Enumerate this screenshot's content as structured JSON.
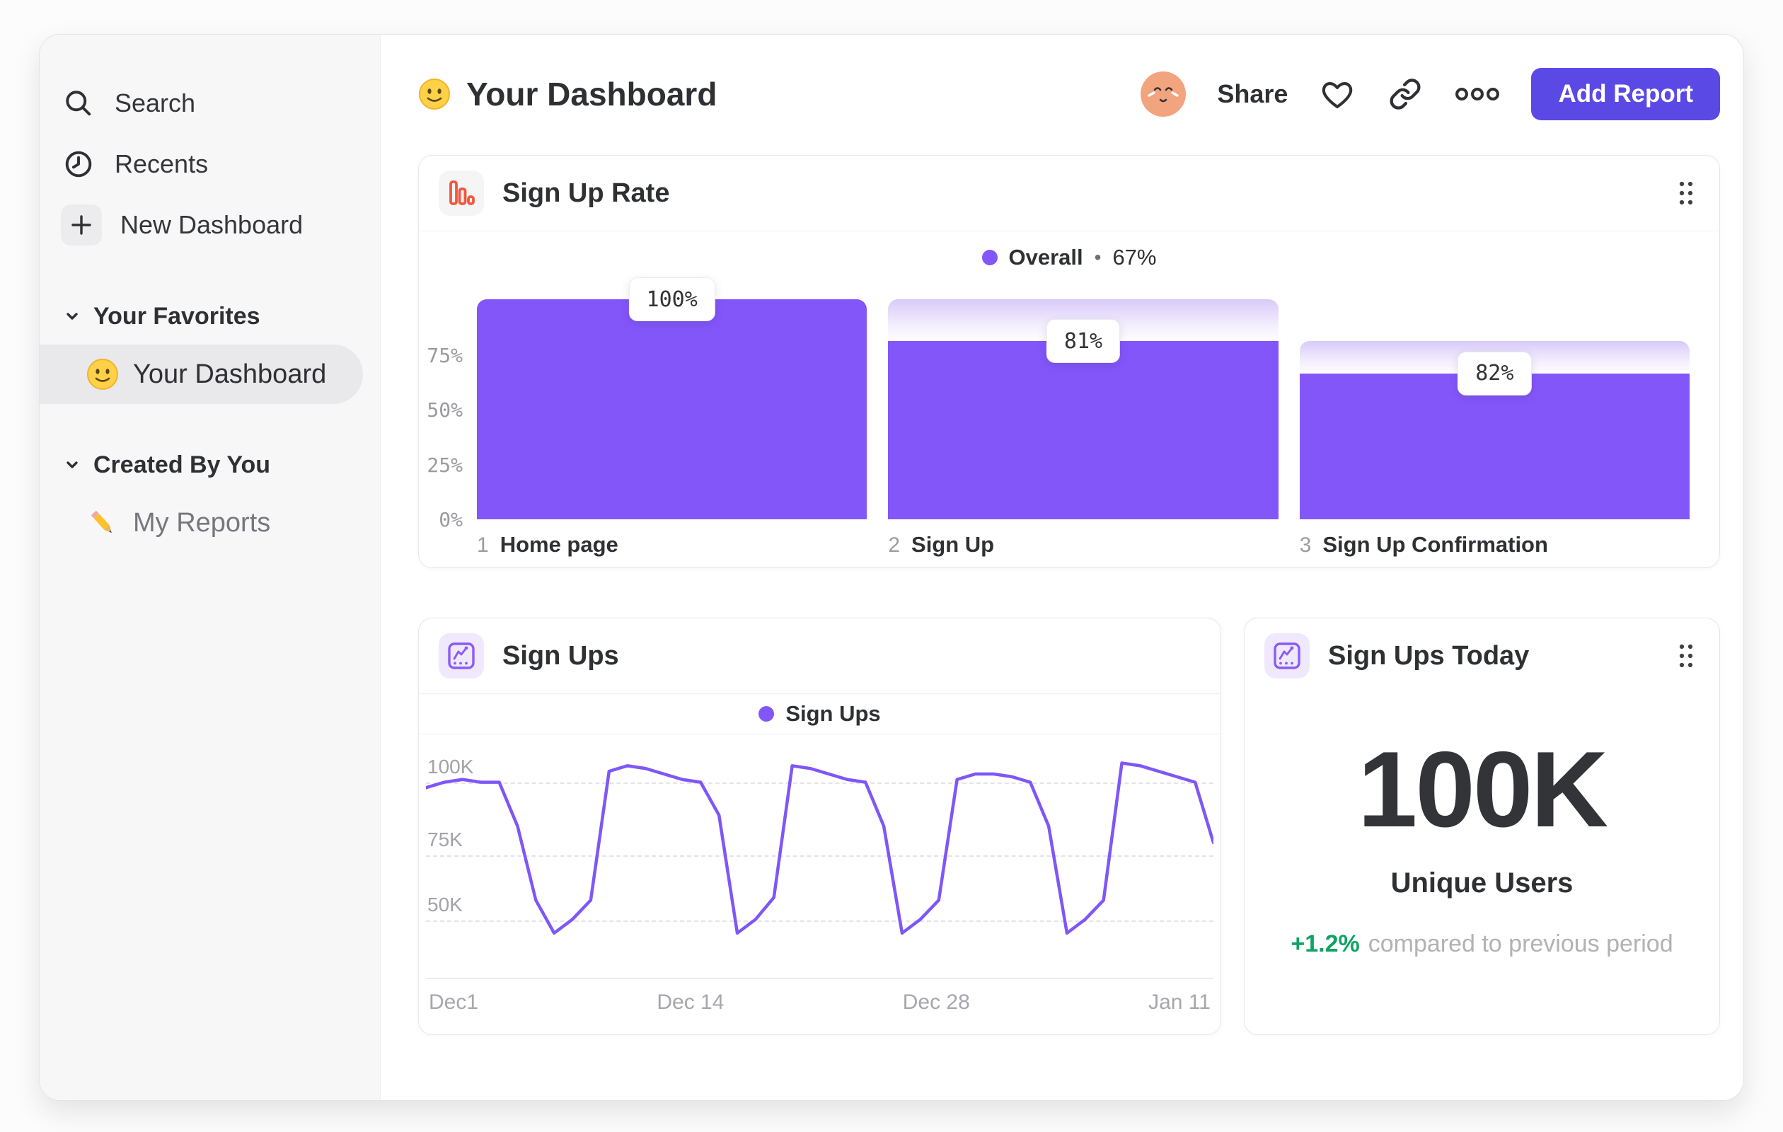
{
  "sidebar": {
    "items": [
      {
        "label": "Search",
        "icon": "search-icon"
      },
      {
        "label": "Recents",
        "icon": "clock-icon"
      },
      {
        "label": "New Dashboard",
        "icon": "plus-icon"
      }
    ],
    "sections": [
      {
        "label": "Your Favorites",
        "items": [
          {
            "label": "Your Dashboard",
            "icon": "smiley-emoji",
            "selected": true
          }
        ]
      },
      {
        "label": "Created By You",
        "items": [
          {
            "label": "My Reports",
            "icon": "pencil-emoji",
            "selected": false
          }
        ]
      }
    ]
  },
  "header": {
    "title": "Your Dashboard",
    "title_emoji": "smiley",
    "share_label": "Share",
    "add_report_label": "Add Report"
  },
  "cards": {
    "funnel": {
      "title": "Sign Up Rate",
      "legend": {
        "series": "Overall",
        "separator": "•",
        "value": "67%"
      }
    },
    "line": {
      "title": "Sign Ups",
      "legend": "Sign Ups"
    },
    "metric": {
      "title": "Sign Ups Today",
      "value": "100K",
      "caption": "Unique Users",
      "delta": "+1.2%",
      "delta_caption": "compared to previous period"
    }
  },
  "colors": {
    "accent_purple": "#8356fa",
    "line_purple": "#7e57f7",
    "button_indigo": "#5b49e6",
    "funnel_icon_orange": "#f2583e",
    "delta_green": "#0fa263",
    "sidebar_bg": "#f7f7f8",
    "grey_text": "#9b9ba1"
  },
  "chart_data": [
    {
      "type": "bar",
      "subtype": "funnel",
      "title": "Sign Up Rate",
      "categories": [
        "Home page",
        "Sign Up",
        "Sign Up Confirmation"
      ],
      "index_labels": [
        "1",
        "2",
        "3"
      ],
      "step_labels": [
        "100%",
        "81%",
        "82%"
      ],
      "step_conversion_pct": [
        100,
        81,
        82
      ],
      "cumulative_pct": [
        100,
        81,
        66.4
      ],
      "prev_cumulative_pct": [
        100,
        100,
        81
      ],
      "overall_conversion_pct": 67,
      "legend": "Overall",
      "ylim": [
        0,
        100
      ],
      "y_tick_values": [
        75,
        50,
        25,
        0
      ],
      "y_tick_labels": [
        "75%",
        "50%",
        "25%",
        "0%"
      ],
      "grid": false,
      "legend_position": "top-center"
    },
    {
      "type": "line",
      "title": "Sign Ups",
      "series": [
        {
          "name": "Sign Ups",
          "values_k": [
            98,
            100,
            101,
            100,
            100,
            84,
            57,
            45,
            50,
            57,
            104,
            106,
            105,
            103,
            101,
            100,
            88,
            45,
            50,
            58,
            106,
            105,
            103,
            101,
            100,
            84,
            45,
            50,
            57,
            101,
            103,
            103,
            102,
            100,
            84,
            45,
            50,
            57,
            107,
            106,
            104,
            102,
            100,
            78
          ]
        }
      ],
      "x_ticks": [
        "Dec1",
        "Dec 14",
        "Dec 28",
        "Jan 11"
      ],
      "ylim_k": [
        40,
        110
      ],
      "y_gridlines_k": [
        100,
        75,
        50
      ],
      "y_gridline_labels": [
        "100K",
        "75K",
        "50K"
      ],
      "grid": "dashed-horizontal",
      "legend_position": "top-center"
    },
    {
      "type": "metric",
      "title": "Sign Ups Today",
      "value": "100K",
      "label": "Unique Users",
      "change_pct": "+1.2%",
      "comparison": "compared to previous period"
    }
  ]
}
